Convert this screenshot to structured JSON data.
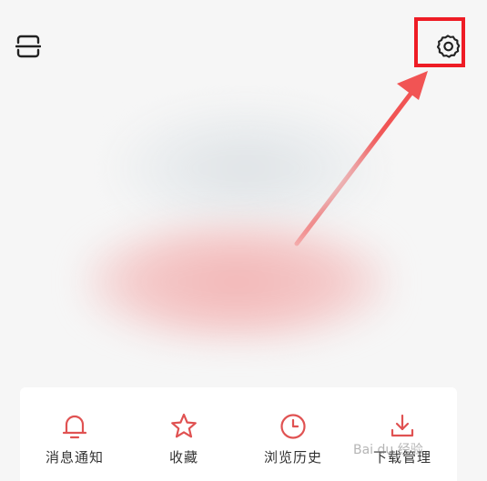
{
  "header": {
    "scan_icon": "scan-icon",
    "settings_icon": "gear-icon"
  },
  "colors": {
    "accent": "#e05252",
    "annotation": "#ee1c25",
    "background": "#f6f6f6"
  },
  "quick_menu": {
    "items": [
      {
        "label": "消息通知",
        "icon": "bell-icon"
      },
      {
        "label": "收藏",
        "icon": "star-icon"
      },
      {
        "label": "浏览历史",
        "icon": "clock-icon"
      },
      {
        "label": "下载管理",
        "icon": "download-icon"
      }
    ]
  },
  "watermark": {
    "text": "Bai du 经验"
  }
}
